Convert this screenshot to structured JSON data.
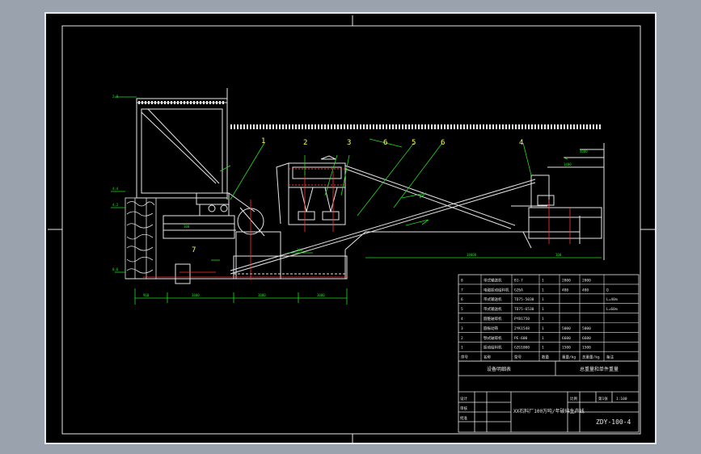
{
  "drawing": {
    "callouts": [
      "1",
      "2",
      "3",
      "6",
      "5",
      "6",
      "4",
      "7"
    ],
    "drawing_number": "ZDY-100-4",
    "assembly_title": "XX石料厂100万吨/年破碎生产线",
    "list_title": "设备明细表",
    "list_title_right": "总重量和单件重量",
    "scale_label": "比例",
    "sheet_label": "第1张"
  },
  "bom": {
    "header": [
      "序号",
      "名称",
      "型号",
      "数量",
      "重量/kg",
      "总重量/kg",
      "备注"
    ],
    "rows": [
      [
        "8",
        "带式输送机",
        "B1-7",
        "1",
        "2800",
        "2800",
        ""
      ],
      [
        "7",
        "电磁振动给料机",
        "GZ6A",
        "1",
        "480",
        "480",
        "Q"
      ],
      [
        "6",
        "带式输送机",
        "TD75-5030",
        "1",
        "",
        "",
        "L=40m"
      ],
      [
        "5",
        "带式输送机",
        "TD75-6530",
        "1",
        "",
        "",
        "L=60m"
      ],
      [
        "4",
        "圆锥破碎机",
        "PYB1750",
        "1",
        "",
        "",
        ""
      ],
      [
        "3",
        "圆振动筛",
        "2YK1548",
        "1",
        "5000",
        "5000",
        ""
      ],
      [
        "2",
        "颚式破碎机",
        "PE-600",
        "1",
        "6600",
        "6600",
        ""
      ],
      [
        "1",
        "振动给料机",
        "GZG1000",
        "1",
        "1500",
        "1500",
        ""
      ]
    ]
  },
  "title_block": {
    "left_labels": [
      "设计",
      "审核",
      "批准"
    ],
    "left_values": [
      "",
      "",
      ""
    ],
    "right_labels": [
      "比例",
      "第1张",
      "1:100"
    ]
  }
}
